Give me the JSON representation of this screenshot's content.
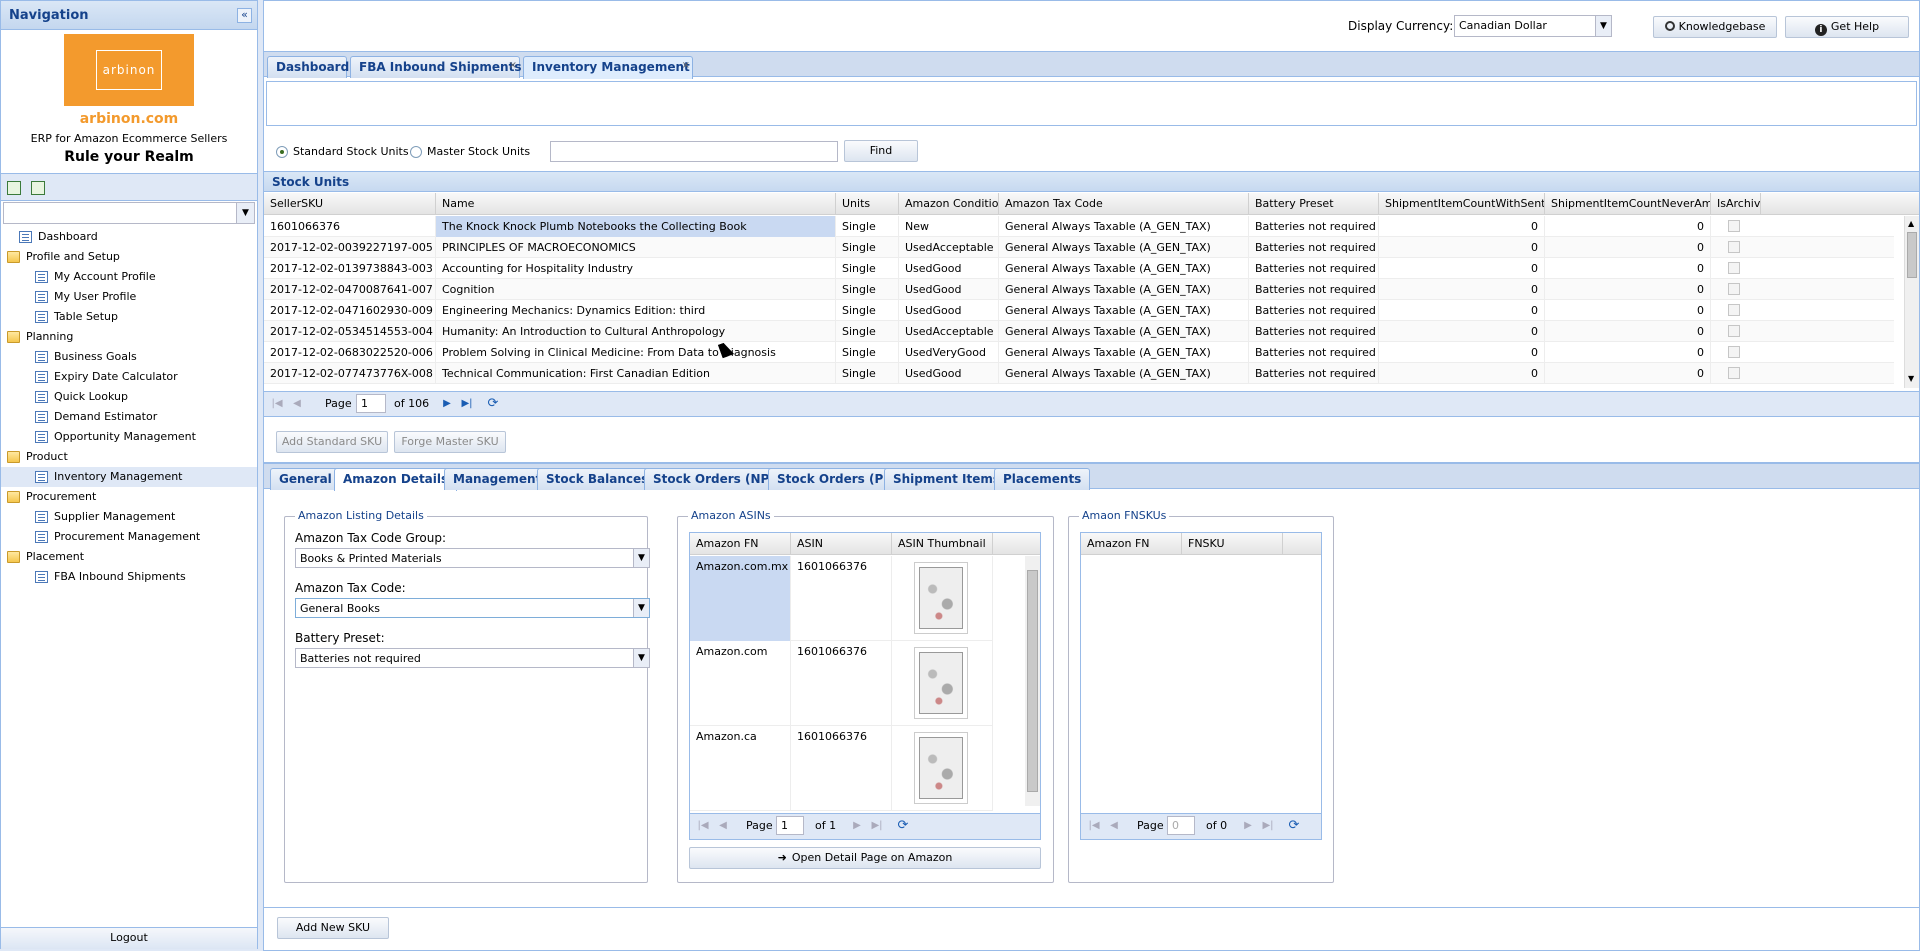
{
  "nav": {
    "title": "Navigation",
    "collapse_glyph": "«",
    "brand": {
      "logo_text": "arbinon",
      "url": "arbinon.com",
      "subtitle": "ERP for Amazon Ecommerce Sellers",
      "tagline": "Rule your Realm"
    },
    "tree": [
      {
        "label": "Dashboard",
        "type": "page",
        "level": 1
      },
      {
        "label": "Profile and Setup",
        "type": "folder",
        "level": 0
      },
      {
        "label": "My Account Profile",
        "type": "page",
        "level": 2
      },
      {
        "label": "My User Profile",
        "type": "page",
        "level": 2
      },
      {
        "label": "Table Setup",
        "type": "page",
        "level": 2
      },
      {
        "label": "Planning",
        "type": "folder",
        "level": 0
      },
      {
        "label": "Business Goals",
        "type": "page",
        "level": 2
      },
      {
        "label": "Expiry Date Calculator",
        "type": "page",
        "level": 2
      },
      {
        "label": "Quick Lookup",
        "type": "page",
        "level": 2
      },
      {
        "label": "Demand Estimator",
        "type": "page",
        "level": 2
      },
      {
        "label": "Opportunity Management",
        "type": "page",
        "level": 2
      },
      {
        "label": "Product",
        "type": "folder",
        "level": 0
      },
      {
        "label": "Inventory Management",
        "type": "page",
        "level": 2,
        "selected": true
      },
      {
        "label": "Procurement",
        "type": "folder",
        "level": 0
      },
      {
        "label": "Supplier Management",
        "type": "page",
        "level": 2
      },
      {
        "label": "Procurement Management",
        "type": "page",
        "level": 2
      },
      {
        "label": "Placement",
        "type": "folder",
        "level": 0
      },
      {
        "label": "FBA Inbound Shipments",
        "type": "page",
        "level": 2
      }
    ],
    "logout": "Logout"
  },
  "topbar": {
    "currency_label": "Display Currency:",
    "currency_value": "Canadian Dollar",
    "knowledgebase": "Knowledgebase",
    "get_help": "Get Help"
  },
  "tabs": [
    {
      "label": "Dashboard",
      "closable": false
    },
    {
      "label": "FBA Inbound Shipments",
      "closable": true
    },
    {
      "label": "Inventory Management",
      "closable": true,
      "active": true
    }
  ],
  "search": {
    "radio_standard": "Standard Stock Units",
    "radio_master": "Master Stock Units",
    "query": "",
    "find": "Find"
  },
  "stock_units": {
    "title": "Stock Units",
    "columns": [
      "SellerSKU",
      "Name",
      "Units",
      "Amazon Condition",
      "Amazon Tax Code",
      "Battery Preset",
      "ShipmentItemCountWithSentFe",
      "ShipmentItemCountNeverAmaz",
      "IsArchive"
    ],
    "rows": [
      [
        "1601066376",
        "The Knock Knock Plumb Notebooks the Collecting Book",
        "Single",
        "New",
        "General Always Taxable (A_GEN_TAX)",
        "Batteries not required",
        "0",
        "0"
      ],
      [
        "2017-12-02-0039227197-005",
        "PRINCIPLES OF MACROECONOMICS",
        "Single",
        "UsedAcceptable",
        "General Always Taxable (A_GEN_TAX)",
        "Batteries not required",
        "0",
        "0"
      ],
      [
        "2017-12-02-0139738843-003",
        "Accounting for Hospitality Industry",
        "Single",
        "UsedGood",
        "General Always Taxable (A_GEN_TAX)",
        "Batteries not required",
        "0",
        "0"
      ],
      [
        "2017-12-02-0470087641-007",
        "Cognition",
        "Single",
        "UsedGood",
        "General Always Taxable (A_GEN_TAX)",
        "Batteries not required",
        "0",
        "0"
      ],
      [
        "2017-12-02-0471602930-009",
        "Engineering Mechanics: Dynamics Edition: third",
        "Single",
        "UsedGood",
        "General Always Taxable (A_GEN_TAX)",
        "Batteries not required",
        "0",
        "0"
      ],
      [
        "2017-12-02-0534514553-004",
        "Humanity: An Introduction to Cultural Anthropology",
        "Single",
        "UsedAcceptable",
        "General Always Taxable (A_GEN_TAX)",
        "Batteries not required",
        "0",
        "0"
      ],
      [
        "2017-12-02-0683022520-006",
        "Problem Solving in Clinical Medicine: From Data to Diagnosis",
        "Single",
        "UsedVeryGood",
        "General Always Taxable (A_GEN_TAX)",
        "Batteries not required",
        "0",
        "0"
      ],
      [
        "2017-12-02-077473776X-008",
        "Technical Communication: First Canadian Edition",
        "Single",
        "UsedGood",
        "General Always Taxable (A_GEN_TAX)",
        "Batteries not required",
        "0",
        "0"
      ]
    ],
    "pager": {
      "page_label": "Page",
      "page": "1",
      "of": "of 106"
    },
    "add_standard": "Add Standard SKU",
    "forge_master": "Forge Master SKU"
  },
  "detail_tabs": [
    {
      "label": "General"
    },
    {
      "label": "Amazon Details",
      "active": true
    },
    {
      "label": "Management"
    },
    {
      "label": "Stock Balances"
    },
    {
      "label": "Stock Orders (NP)"
    },
    {
      "label": "Stock Orders (P)"
    },
    {
      "label": "Shipment Items"
    },
    {
      "label": "Placements"
    }
  ],
  "listing": {
    "legend": "Amazon Listing Details",
    "tax_group_label": "Amazon Tax Code Group:",
    "tax_group_value": "Books & Printed Materials",
    "tax_code_label": "Amazon Tax Code:",
    "tax_code_value": "General Books",
    "battery_label": "Battery Preset:",
    "battery_value": "Batteries not required"
  },
  "asins": {
    "legend": "Amazon ASINs",
    "columns": [
      "Amazon FN",
      "ASIN",
      "ASIN Thumbnail"
    ],
    "rows": [
      {
        "fn": "Amazon.com.mx",
        "asin": "1601066376"
      },
      {
        "fn": "Amazon.com",
        "asin": "1601066376"
      },
      {
        "fn": "Amazon.ca",
        "asin": "1601066376"
      }
    ],
    "pager": {
      "page_label": "Page",
      "page": "1",
      "of": "of 1"
    },
    "open_detail": "Open Detail Page on Amazon"
  },
  "fnskus": {
    "legend": "Amaon FNSKUs",
    "columns": [
      "Amazon FN",
      "FNSKU"
    ],
    "pager": {
      "page_label": "Page",
      "page": "0",
      "of": "of 0"
    }
  },
  "bottom": {
    "add_new_sku": "Add New SKU"
  }
}
